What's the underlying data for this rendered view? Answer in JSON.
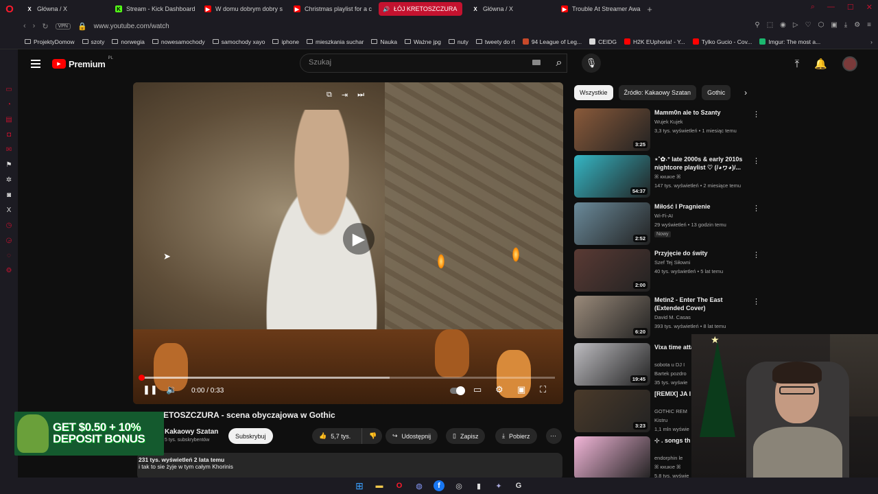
{
  "browser": {
    "tabs": [
      {
        "title": "Główna / X",
        "icon": "x-logo-icon"
      },
      {
        "title": "Stream - Kick Dashboard",
        "icon": "kick-logo-icon"
      },
      {
        "title": "W domu dobrym dobry s",
        "icon": "youtube-icon"
      },
      {
        "title": "Christmas playlist for a c",
        "icon": "youtube-icon"
      },
      {
        "title": "ŁÓJ KRETOSZCZURA",
        "icon": "audio-icon",
        "active": true
      },
      {
        "title": "Główna / X",
        "icon": "x-logo-icon"
      },
      {
        "title": "Trouble At Streamer Awar",
        "icon": "youtube-icon"
      }
    ],
    "vpn_label": "VPN",
    "url": "www.youtube.com/watch",
    "bookmarks": [
      {
        "label": "ProjektyDomow",
        "type": "folder"
      },
      {
        "label": "szoty",
        "type": "folder"
      },
      {
        "label": "norwegia",
        "type": "folder"
      },
      {
        "label": "nowesamochody",
        "type": "folder"
      },
      {
        "label": "samochody xayo",
        "type": "folder"
      },
      {
        "label": "iphone",
        "type": "folder"
      },
      {
        "label": "mieszkania suchar",
        "type": "folder"
      },
      {
        "label": "Nauka",
        "type": "folder"
      },
      {
        "label": "Ważne jpg",
        "type": "folder"
      },
      {
        "label": "nuty",
        "type": "folder"
      },
      {
        "label": "tweety do rt",
        "type": "folder"
      },
      {
        "label": "94 League of Leg...",
        "type": "site",
        "color": "#c8492a"
      },
      {
        "label": "CEIDG",
        "type": "site",
        "color": "#d8d8d8"
      },
      {
        "label": "H2K EUphoria! - Y...",
        "type": "site",
        "color": "#ff0000"
      },
      {
        "label": "Tylko Gucio - Cov...",
        "type": "site",
        "color": "#ff0000"
      },
      {
        "label": "Imgur: The most a...",
        "type": "site",
        "color": "#1bb76e"
      }
    ]
  },
  "youtube": {
    "logo_text": "Premium",
    "region": "PL",
    "search_placeholder": "Szukaj"
  },
  "player": {
    "time": "0:00 / 0:33",
    "progress": 0.0,
    "buffered": 0.6
  },
  "video": {
    "title": "ŁÓJ KRETOSZCZURA - scena obyczajowa w Gothic",
    "visible_title": "ETOSZCZURA - scena obyczajowa w Gothic",
    "channel": "Kakaowy Szatan",
    "subscribers": "5 tys. subskrybentów",
    "subscribe_label": "Subskrybuj",
    "likes": "5,7 tys.",
    "share_label": "Udostępnij",
    "save_label": "Zapisz",
    "download_label": "Pobierz",
    "views_date": "231 tys. wyświetleń  2 lata temu",
    "desc_line": "i tak to sie żyje w tym całym Khorinis"
  },
  "ad": {
    "line1": "GET $0.50 + 10%",
    "line2": "DEPOSIT BONUS"
  },
  "chips": [
    "Wszystkie",
    "Źródło: Kakaowy Szatan",
    "Gothic"
  ],
  "recommendations": [
    {
      "title": "Mamm0n ale to Szanty",
      "channel": "Wujek Kujek",
      "meta": "3,3 tys. wyświetleń • 1 miesiąc temu",
      "duration": "3:25",
      "color": "#8a5a3a"
    },
    {
      "title": "⋆˚✿˖° late 2000s & early 2010s nightcore playlist ♡ (/◕ヮ◕)/...",
      "channel": "ꕤ ĸĸuĸıe ꕤ",
      "meta": "147 tys. wyświetleń • 2 miesiące temu",
      "duration": "54:37",
      "color": "#35b6c4"
    },
    {
      "title": "Miłość I Pragnienie",
      "channel": "Wi-Fi-AI",
      "meta": "29 wyświetleń • 13 godzin temu",
      "duration": "2:52",
      "badge": "Nowy",
      "color": "#6a8a9a"
    },
    {
      "title": "Przyjęcie do świty",
      "channel": "Szef Tej Siłowni",
      "meta": "40 tys. wyświetleń • 5 lat temu",
      "duration": "2:00",
      "color": "#5a3a34"
    },
    {
      "title": "Metin2 - Enter The East (Extended Cover)",
      "channel": "David M. Casas",
      "meta": "393 tys. wyświetleń • 8 lat temu",
      "duration": "6:20",
      "color": "#9a8a7a"
    },
    {
      "title": "Vixa time atta",
      "channel": "sobota u DJ I",
      "meta": "Bartek pozdro",
      "meta2": "35 tys. wyświe",
      "duration": "19:45",
      "color": "#bdbcc0"
    },
    {
      "title": "[REMIX] JA I",
      "channel": "GOTHIC REM",
      "meta": "Kistru",
      "meta2": "1,1 mln wyświe",
      "duration": "3:23",
      "color": "#4a3a2a"
    },
    {
      "title": "⊹ . songs th",
      "channel": "endorphin le",
      "meta": "ꕤ ĸĸuĸıe ꕤ",
      "meta2": "5,8 tys. wyświe",
      "duration": "",
      "color": "#f2b6d8"
    }
  ],
  "colors": {
    "accent": "#ff0000",
    "opera_red": "#c4122f",
    "bg": "#0f0f0f"
  }
}
